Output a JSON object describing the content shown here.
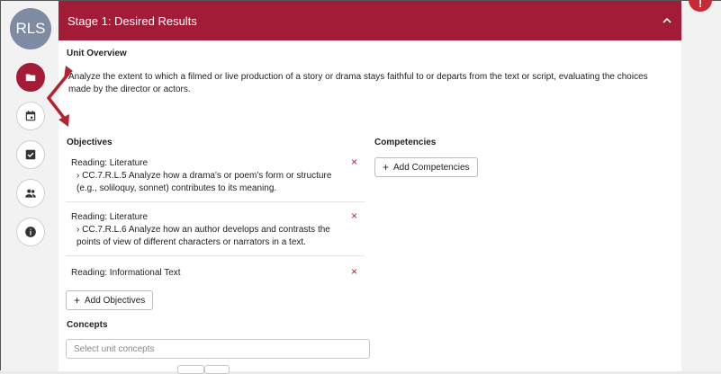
{
  "user": {
    "initials": "RLS"
  },
  "sidebar": {
    "items": [
      {
        "name": "folder",
        "active": true
      },
      {
        "name": "calendar",
        "active": false
      },
      {
        "name": "checkbox",
        "active": false
      },
      {
        "name": "people",
        "active": false
      },
      {
        "name": "info",
        "active": false
      }
    ]
  },
  "stage": {
    "title": "Stage 1: Desired Results"
  },
  "unit_overview": {
    "label": "Unit Overview",
    "line1": "Analyze the extent to which a filmed or live production of a story or drama stays faithful to or departs from the text or script, evaluating the choices",
    "line2": "made by the director or actors."
  },
  "objectives": {
    "label": "Objectives",
    "items": [
      {
        "category": "Reading: Literature",
        "standard_line1": "CC.7.R.L.5 Analyze how a drama's or poem's form or structure",
        "standard_line2": "(e.g., soliloquy, sonnet) contributes to its meaning."
      },
      {
        "category": "Reading: Literature",
        "standard_line1": "CC.7.R.L.6 Analyze how an author develops and contrasts the",
        "standard_line2": "points of view of different characters or narrators in a text."
      },
      {
        "category": "Reading: Informational Text"
      }
    ],
    "remove_symbol": "×",
    "chevron_symbol": "›",
    "add_label": "Add Objectives"
  },
  "competencies": {
    "label": "Competencies",
    "add_label": "Add Competencies"
  },
  "concepts": {
    "label": "Concepts",
    "placeholder": "Select unit concepts"
  },
  "colors": {
    "brand": "#a31c37",
    "remove": "#b3232f",
    "avatar": "#7f8aa3",
    "arrow": "#b3232f"
  }
}
